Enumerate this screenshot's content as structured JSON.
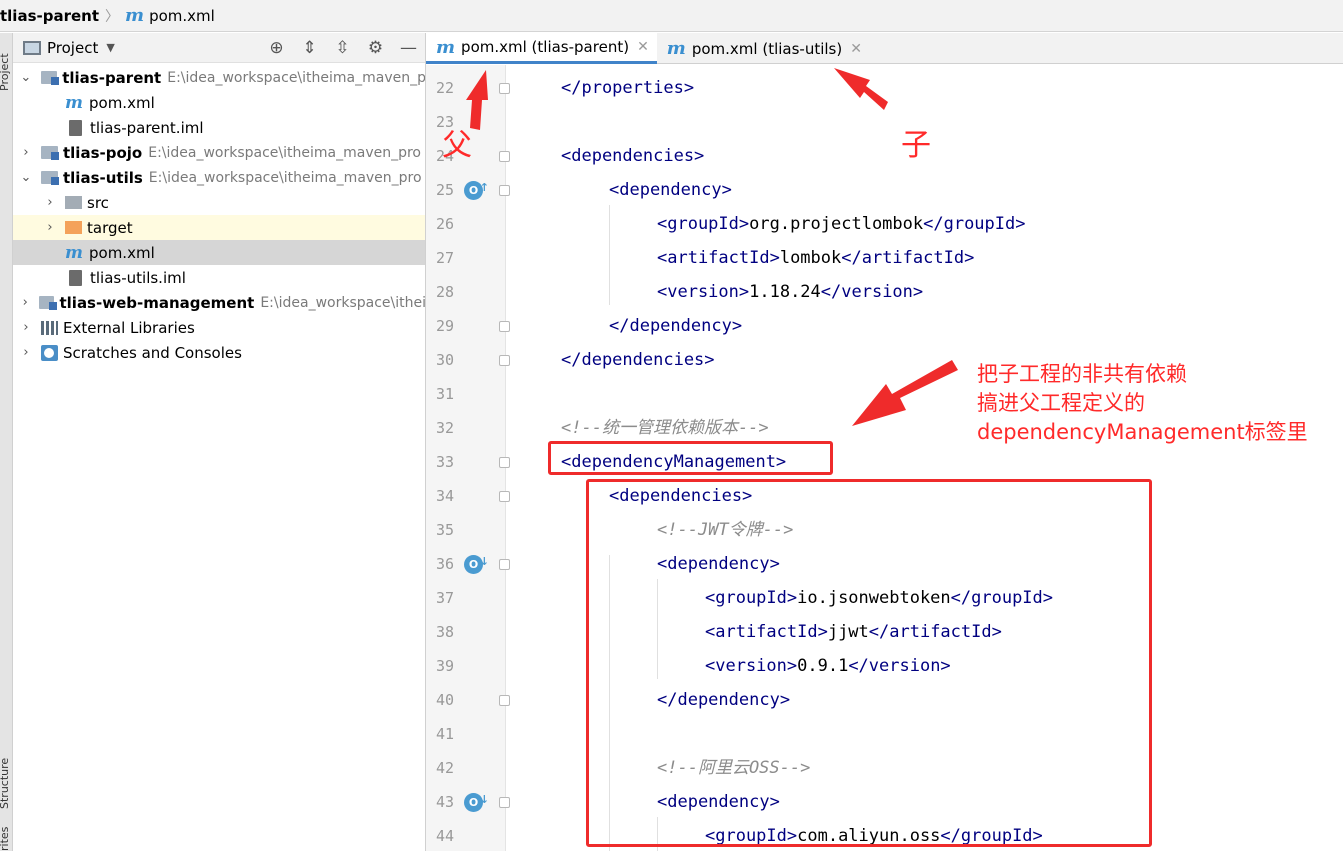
{
  "breadcrumb": {
    "project": "tlias-parent",
    "file": "pom.xml"
  },
  "side_strip": {
    "top_label": "Project",
    "mid_label": "Structure",
    "bottom_label": "rites"
  },
  "project_panel": {
    "title": "Project",
    "tree": [
      {
        "label": "tlias-parent",
        "path": "E:\\idea_workspace\\itheima_maven_p"
      },
      {
        "label": "pom.xml"
      },
      {
        "label": "tlias-parent.iml"
      },
      {
        "label": "tlias-pojo",
        "path": "E:\\idea_workspace\\itheima_maven_pro"
      },
      {
        "label": "tlias-utils",
        "path": "E:\\idea_workspace\\itheima_maven_pro"
      },
      {
        "label": "src"
      },
      {
        "label": "target"
      },
      {
        "label": "pom.xml"
      },
      {
        "label": "tlias-utils.iml"
      },
      {
        "label": "tlias-web-management",
        "path": "E:\\idea_workspace\\ithei"
      },
      {
        "label": "External Libraries"
      },
      {
        "label": "Scratches and Consoles"
      }
    ]
  },
  "tabs": [
    {
      "label": "pom.xml (tlias-parent)",
      "active": true
    },
    {
      "label": "pom.xml (tlias-utils)",
      "active": false
    }
  ],
  "editor": {
    "lines": [
      {
        "n": "22",
        "indent": 1,
        "text": "</properties>"
      },
      {
        "n": "23",
        "indent": 0,
        "text": ""
      },
      {
        "n": "24",
        "indent": 1,
        "text": "<dependencies>"
      },
      {
        "n": "25",
        "indent": 2,
        "text": "<dependency>"
      },
      {
        "n": "26",
        "indent": 3,
        "text": "<groupId>org.projectlombok</groupId>"
      },
      {
        "n": "27",
        "indent": 3,
        "text": "<artifactId>lombok</artifactId>"
      },
      {
        "n": "28",
        "indent": 3,
        "text": "<version>1.18.24</version>"
      },
      {
        "n": "29",
        "indent": 2,
        "text": "</dependency>"
      },
      {
        "n": "30",
        "indent": 1,
        "text": "</dependencies>"
      },
      {
        "n": "31",
        "indent": 0,
        "text": ""
      },
      {
        "n": "32",
        "indent": 1,
        "text": "<!--统一管理依赖版本-->"
      },
      {
        "n": "33",
        "indent": 1,
        "text": "<dependencyManagement>"
      },
      {
        "n": "34",
        "indent": 2,
        "text": "<dependencies>"
      },
      {
        "n": "35",
        "indent": 3,
        "text": "<!--JWT令牌-->"
      },
      {
        "n": "36",
        "indent": 3,
        "text": "<dependency>"
      },
      {
        "n": "37",
        "indent": 4,
        "text": "<groupId>io.jsonwebtoken</groupId>"
      },
      {
        "n": "38",
        "indent": 4,
        "text": "<artifactId>jjwt</artifactId>"
      },
      {
        "n": "39",
        "indent": 4,
        "text": "<version>0.9.1</version>"
      },
      {
        "n": "40",
        "indent": 3,
        "text": "</dependency>"
      },
      {
        "n": "41",
        "indent": 0,
        "text": ""
      },
      {
        "n": "42",
        "indent": 3,
        "text": "<!--阿里云OSS-->"
      },
      {
        "n": "43",
        "indent": 3,
        "text": "<dependency>"
      },
      {
        "n": "44",
        "indent": 4,
        "text": "<groupId>com.aliyun.oss</groupId>"
      }
    ]
  },
  "annotations": {
    "parent_label": "父",
    "child_label": "子",
    "note_lines": [
      "把子工程的非共有依赖",
      "搞进父工程定义的",
      "dependencyManagement标签里"
    ],
    "color": "#ef2b2b"
  },
  "colors": {
    "tag": "#000080",
    "comment": "#8c8c8c",
    "accent": "#4083c9",
    "maven_icon": "#3a8fd0"
  }
}
